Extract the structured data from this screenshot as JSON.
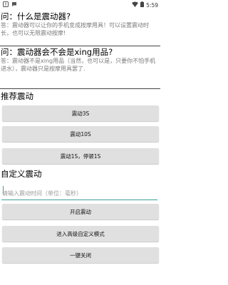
{
  "status_bar": {
    "icons_left": [
      "alert-icon",
      "chat-icon"
    ],
    "wifi_icon": "wifi-icon",
    "battery_icon": "battery-icon",
    "time": "5:59"
  },
  "faq": [
    {
      "question": "问：什么是震动器?",
      "answer": "答：震动器可以让你的手机变成按摩用具！可以设置震动时长，也可以无限震动按摩!"
    },
    {
      "question": "问：震动器会不会是xing用品?",
      "answer": "答：震动器不是xing用品（当然，也可以是，只要你不怕手机进水），震动器只是按摩用具罢了."
    }
  ],
  "recommend": {
    "title": "推荐震动",
    "buttons": [
      "震动3S",
      "震动10S",
      "震动1S，停顿1S"
    ]
  },
  "custom": {
    "title": "自定义震动",
    "input_placeholder": "请输入震动时间（单位：毫秒）",
    "input_value": "",
    "start_button": "开启震动",
    "advanced_button": "进入高级自定义模式",
    "close_button": "一键关闭"
  },
  "colors": {
    "accent": "#3aa29a",
    "button_bg": "#e0e0e0"
  }
}
